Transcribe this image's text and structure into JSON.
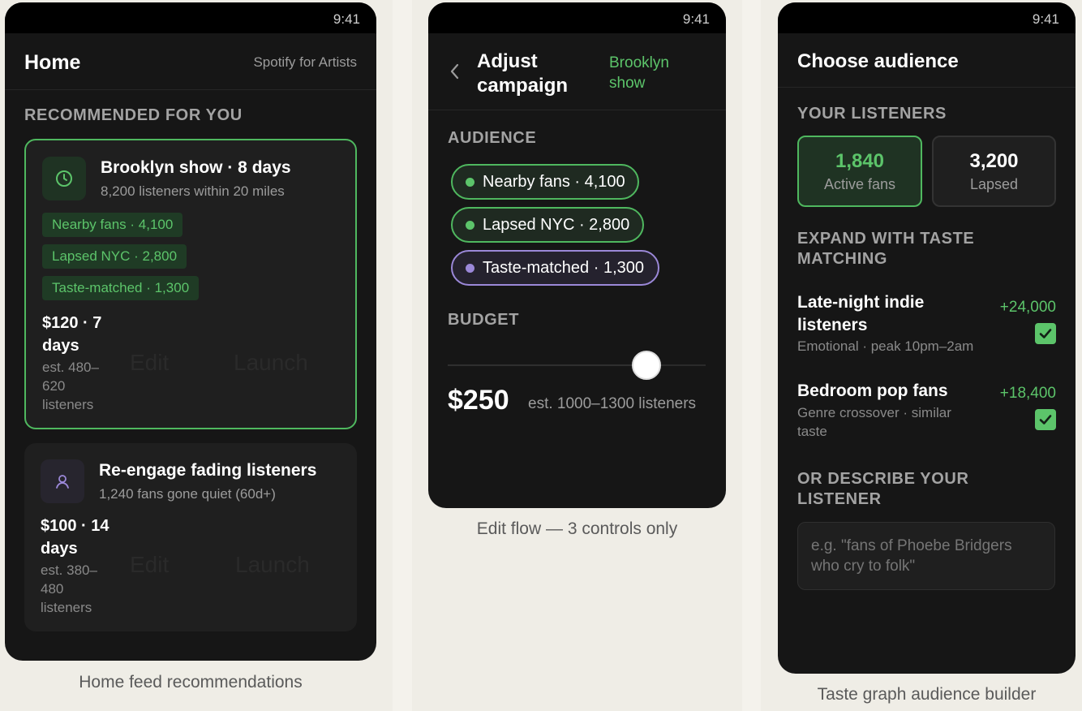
{
  "status_time": "9:41",
  "home": {
    "title": "Home",
    "brand": "Spotify for Artists",
    "section_label": "RECOMMENDED FOR YOU",
    "card1": {
      "title": "Brooklyn show · 8 days",
      "subtitle": "8,200 listeners within 20 miles",
      "tags": [
        "Nearby fans · 4,100",
        "Lapsed NYC · 2,800",
        "Taste-matched · 1,300"
      ],
      "price": "$120 · 7 days",
      "estimate": "est. 480–620 listeners",
      "edit_label": "Edit",
      "launch_label": "Launch",
      "icon": "clock-icon"
    },
    "card2": {
      "title": "Re-engage fading listeners",
      "subtitle": "1,240 fans gone quiet (60d+)",
      "price": "$100 · 14 days",
      "estimate": "est. 380–480 listeners",
      "edit_label": "Edit",
      "launch_label": "Launch",
      "icon": "person-icon"
    },
    "caption": "Home feed recommendations"
  },
  "adjust": {
    "title": "Adjust campaign",
    "context": "Brooklyn show",
    "audience_label": "AUDIENCE",
    "pills": [
      {
        "label": "Nearby fans · 4,100",
        "color": "#5cc46a"
      },
      {
        "label": "Lapsed NYC · 2,800",
        "color": "#5cc46a"
      },
      {
        "label": "Taste-matched · 1,300",
        "color": "#9b88d8"
      }
    ],
    "budget_label": "BUDGET",
    "budget_level": 0.77,
    "budget_value": "$250",
    "budget_estimate": "est. 1000–1300 listeners",
    "caption": "Edit flow — 3 controls only"
  },
  "choose": {
    "title": "Choose audience",
    "listeners_label": "YOUR LISTENERS",
    "stat1": {
      "value": "1,840",
      "label": "Active fans"
    },
    "stat2": {
      "value": "3,200",
      "label": "Lapsed"
    },
    "expand_label": "EXPAND WITH TASTE MATCHING",
    "items": [
      {
        "title": "Late-night indie listeners",
        "subtitle": "Emotional · peak 10pm–2am",
        "delta": "+24,000",
        "checked": true
      },
      {
        "title": "Bedroom pop fans",
        "subtitle": "Genre crossover · similar taste",
        "delta": "+18,400",
        "checked": true
      }
    ],
    "describe_label": "OR DESCRIBE YOUR LISTENER",
    "describe_placeholder": "e.g. \"fans of Phoebe Bridgers who cry to folk\"",
    "caption": "Taste graph audience builder"
  },
  "colors": {
    "accent": "#5cc46a",
    "purple": "#9b88d8",
    "background": "#161616"
  }
}
